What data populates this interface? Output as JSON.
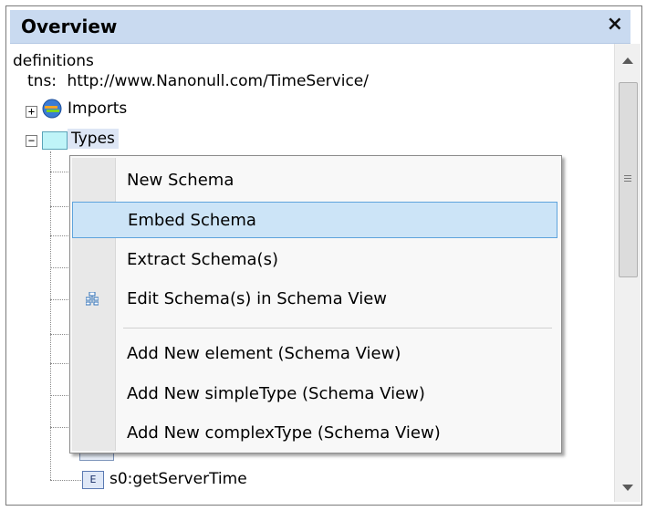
{
  "panel": {
    "title": "Overview",
    "close_glyph": "×"
  },
  "tree": {
    "root_label": "definitions",
    "tns_label": "tns:",
    "tns_value": "http://www.Nanonull.com/TimeService/",
    "imports_label": "Imports",
    "imports_expander": "+",
    "types_label": "Types",
    "types_expander": "−",
    "element_badge": "E",
    "element_label": "s0:getServerTime"
  },
  "context_menu": {
    "items": [
      {
        "label": "New Schema"
      },
      {
        "label": "Embed Schema",
        "highlighted": true
      },
      {
        "label": "Extract Schema(s)"
      },
      {
        "label": "Edit Schema(s) in Schema View",
        "icon": "schema-view-icon"
      },
      {
        "label": "Add New element (Schema View)"
      },
      {
        "label": "Add New simpleType (Schema View)"
      },
      {
        "label": "Add New complexType (Schema View)"
      }
    ]
  },
  "colors": {
    "title_bg": "#c9daf0",
    "highlight_bg": "#cce4f7",
    "highlight_border": "#5ea3dc"
  }
}
